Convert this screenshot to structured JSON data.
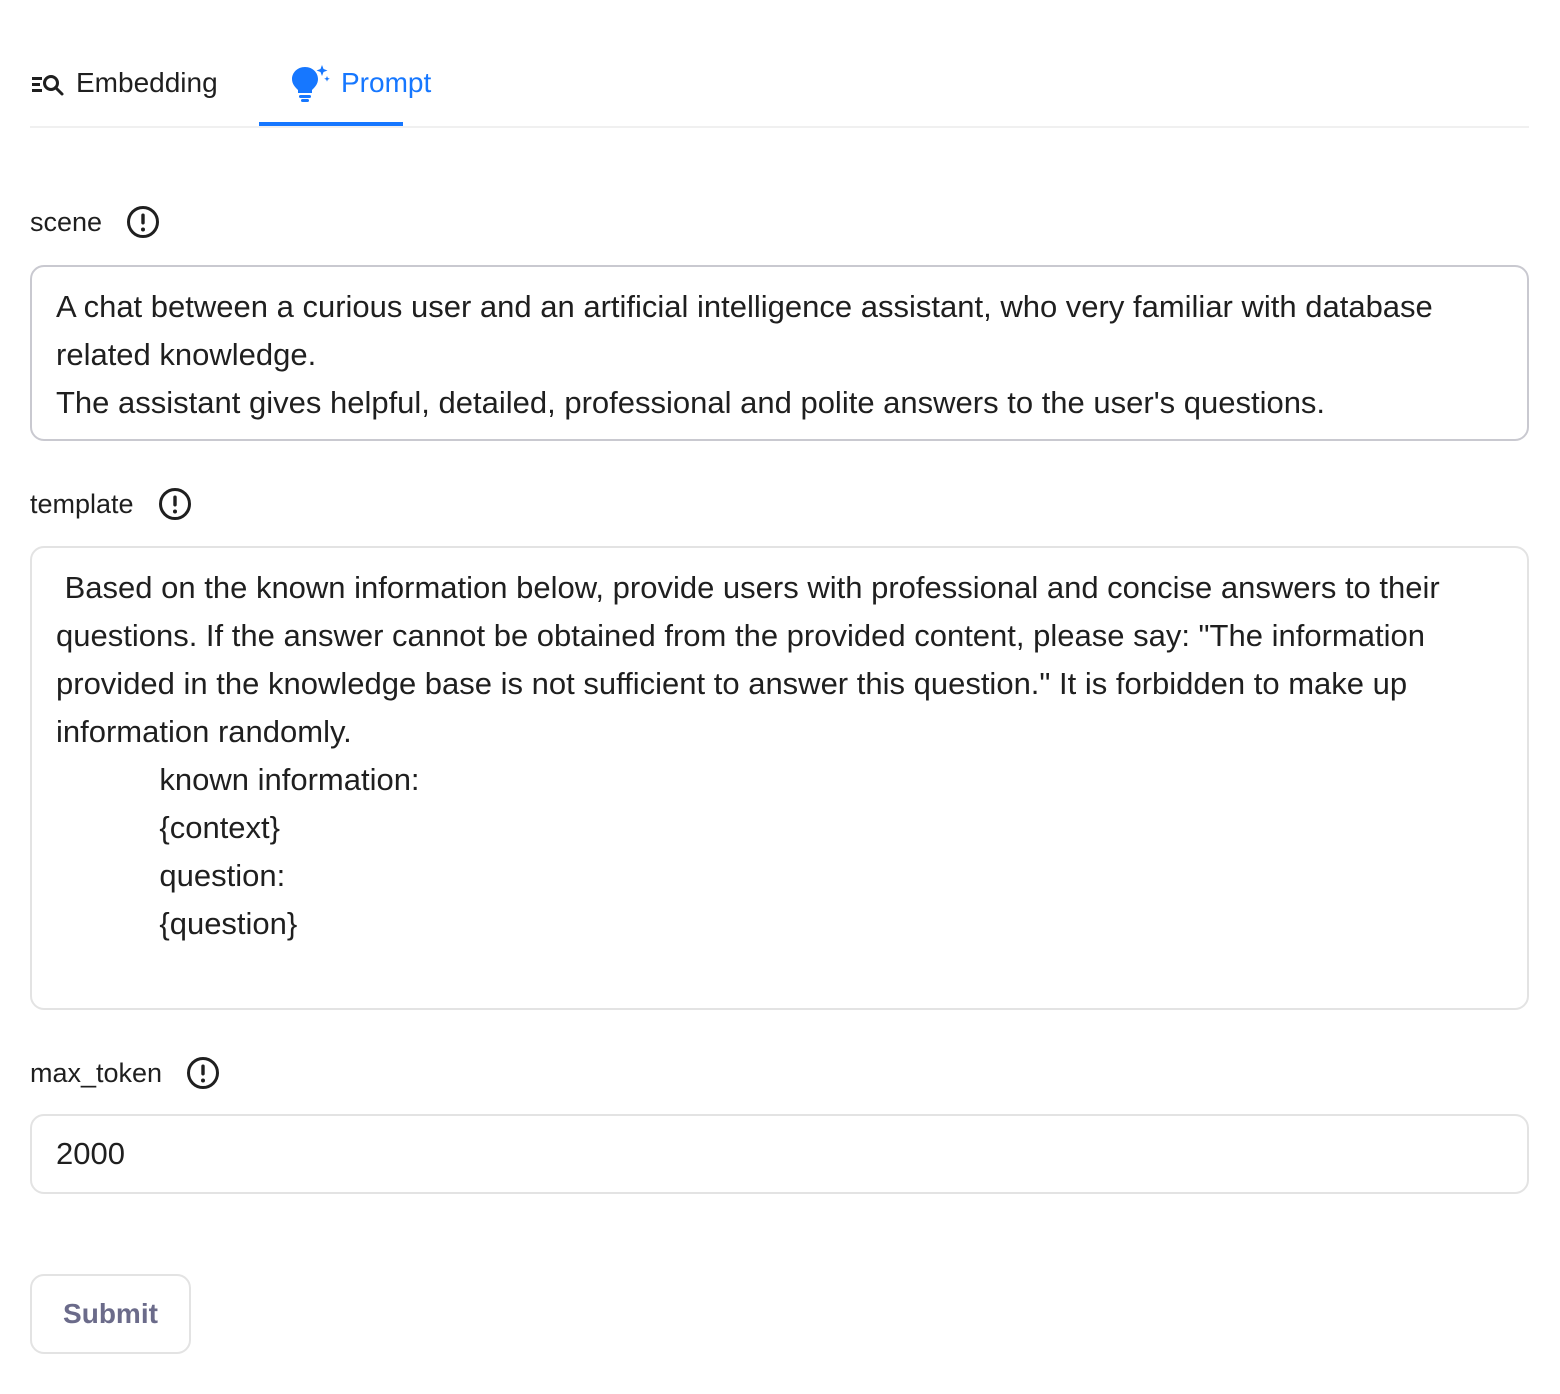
{
  "tabs": [
    {
      "label": "Embedding",
      "icon": "search-list-icon",
      "active": false
    },
    {
      "label": "Prompt",
      "icon": "lightbulb-sparkle-icon",
      "active": true
    }
  ],
  "colors": {
    "accent": "#1677ff",
    "text": "#1f1f1f",
    "border": "#e3e3e3",
    "submit_text": "#6b6b8a"
  },
  "form": {
    "scene": {
      "label": "scene",
      "value": "A chat between a curious user and an artificial intelligence assistant, who very familiar with database related knowledge.\nThe assistant gives helpful, detailed, professional and polite answers to the user's questions."
    },
    "template": {
      "label": "template",
      "value": " Based on the known information below, provide users with professional and concise answers to their questions. If the answer cannot be obtained from the provided content, please say: \"The information provided in the knowledge base is not sufficient to answer this question.\" It is forbidden to make up information randomly.\n            known information:\n            {context}\n            question:\n            {question}"
    },
    "max_token": {
      "label": "max_token",
      "value": "2000"
    },
    "submit_label": "Submit"
  }
}
